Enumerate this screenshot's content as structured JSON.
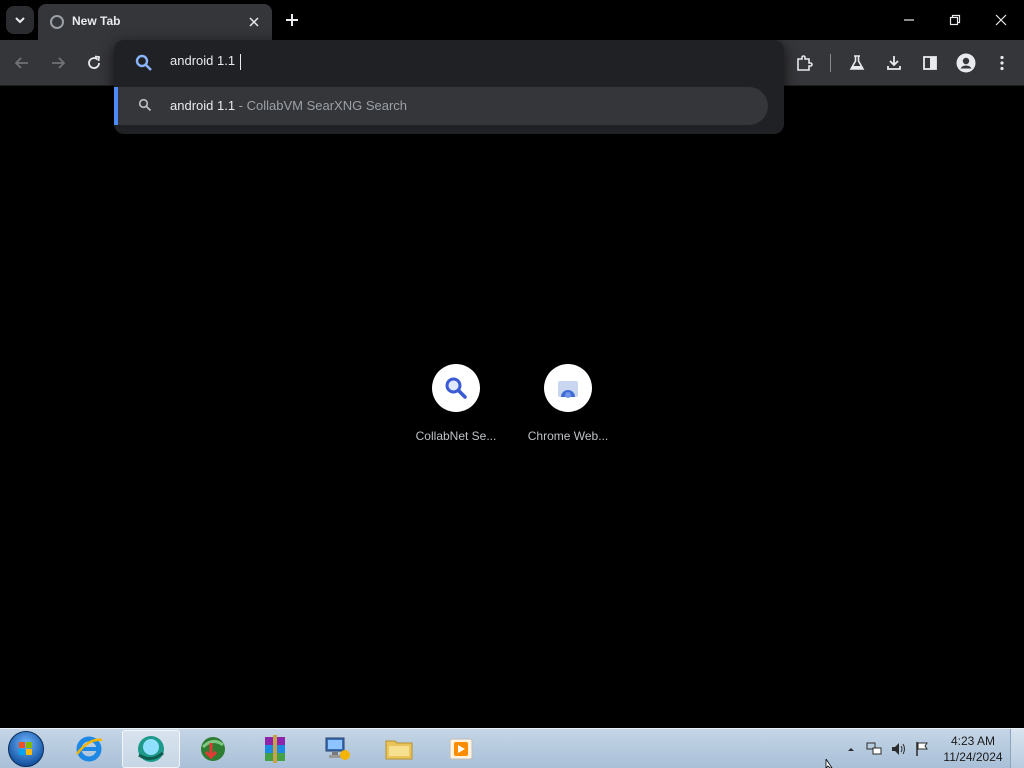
{
  "browser": {
    "tab": {
      "title": "New Tab"
    },
    "omnibox": {
      "input_value": "android 1.1",
      "suggestion": {
        "query": "android 1.1",
        "separator": " - ",
        "engine": "CollabVM SearXNG Search"
      }
    },
    "icons": {
      "tab_search": "chevron-down-icon",
      "tab_close": "close-icon",
      "new_tab": "plus-icon",
      "minimize": "minimize-icon",
      "restore": "restore-icon",
      "close_window": "close-icon",
      "back": "arrow-left-icon",
      "forward": "arrow-right-icon",
      "reload": "reload-icon",
      "search": "search-icon",
      "extensions": "puzzle-icon",
      "labs": "flask-icon",
      "downloads": "download-icon",
      "side_panel": "side-panel-icon",
      "profile": "profile-icon",
      "menu": "kebab-menu-icon"
    },
    "accent_color": "#4c8bf5"
  },
  "new_tab_page": {
    "shortcuts": [
      {
        "label": "CollabNet Se...",
        "icon": "search-icon"
      },
      {
        "label": "Chrome Web...",
        "icon": "chrome-web-store-icon"
      }
    ]
  },
  "taskbar": {
    "apps": [
      {
        "name": "internet-explorer",
        "icon": "ie-icon",
        "active": false
      },
      {
        "name": "browser",
        "icon": "browser-icon",
        "active": true
      },
      {
        "name": "internet-download-manager",
        "icon": "idm-icon",
        "active": false
      },
      {
        "name": "winrar",
        "icon": "winrar-icon",
        "active": false
      },
      {
        "name": "network-computer",
        "icon": "computer-icon",
        "active": false
      },
      {
        "name": "file-explorer",
        "icon": "folder-icon",
        "active": false
      },
      {
        "name": "media-player",
        "icon": "media-player-icon",
        "active": false
      }
    ],
    "clock": {
      "time": "4:23 AM",
      "date": "11/24/2024"
    }
  }
}
